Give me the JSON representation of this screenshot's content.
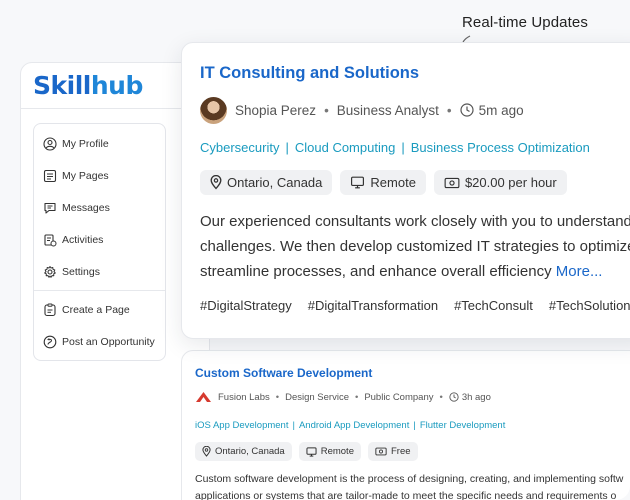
{
  "annotation": {
    "label": "Real-time Updates"
  },
  "brand": {
    "part1": "Skill",
    "part2": "hub",
    "color": "#1a67c9"
  },
  "sidebar": {
    "items": [
      {
        "label": "My Profile",
        "icon": "user-circle-icon"
      },
      {
        "label": "My Pages",
        "icon": "pages-icon"
      },
      {
        "label": "Messages",
        "icon": "message-icon"
      },
      {
        "label": "Activities",
        "icon": "activities-icon"
      },
      {
        "label": "Settings",
        "icon": "gear-icon"
      },
      {
        "label": "Create a Page",
        "icon": "create-page-icon"
      },
      {
        "label": "Post an Opportunity",
        "icon": "post-opportunity-icon"
      }
    ]
  },
  "post1": {
    "title": "IT Consulting and Solutions",
    "author": "Shopia Perez",
    "role": "Business Analyst",
    "time": "5m ago",
    "tags": [
      "Cybersecurity",
      "Cloud Computing",
      "Business Process Optimization"
    ],
    "location": "Ontario, Canada",
    "work_mode": "Remote",
    "rate": "$20.00 per hour",
    "desc_line1": "Our experienced consultants work closely with you to understand y",
    "desc_line2": "challenges. We then develop customized IT strategies to optimize y",
    "desc_line3": "streamline processes, and enhance overall efficiency",
    "more": "More...",
    "hashtags": [
      "#DigitalStrategy",
      "#DigitalTransformation",
      "#TechConsult",
      "#TechSolutions"
    ]
  },
  "post2": {
    "title": "Custom Software Development",
    "company": "Fusion Labs",
    "service": "Design Service",
    "company_type": "Public Company",
    "time": "3h ago",
    "tags": [
      "iOS App Development",
      "Android App Development",
      "Flutter Development"
    ],
    "location": "Ontario, Canada",
    "work_mode": "Remote",
    "rate": "Free",
    "desc_line1": "Custom software development is the process of designing, creating, and implementing softw",
    "desc_line2": "applications or systems that are tailor-made to meet the specific needs and requirements o"
  },
  "colors": {
    "accent": "#1a67c9",
    "tag": "#1a9bbf",
    "company_logo": "#d63a2f"
  }
}
